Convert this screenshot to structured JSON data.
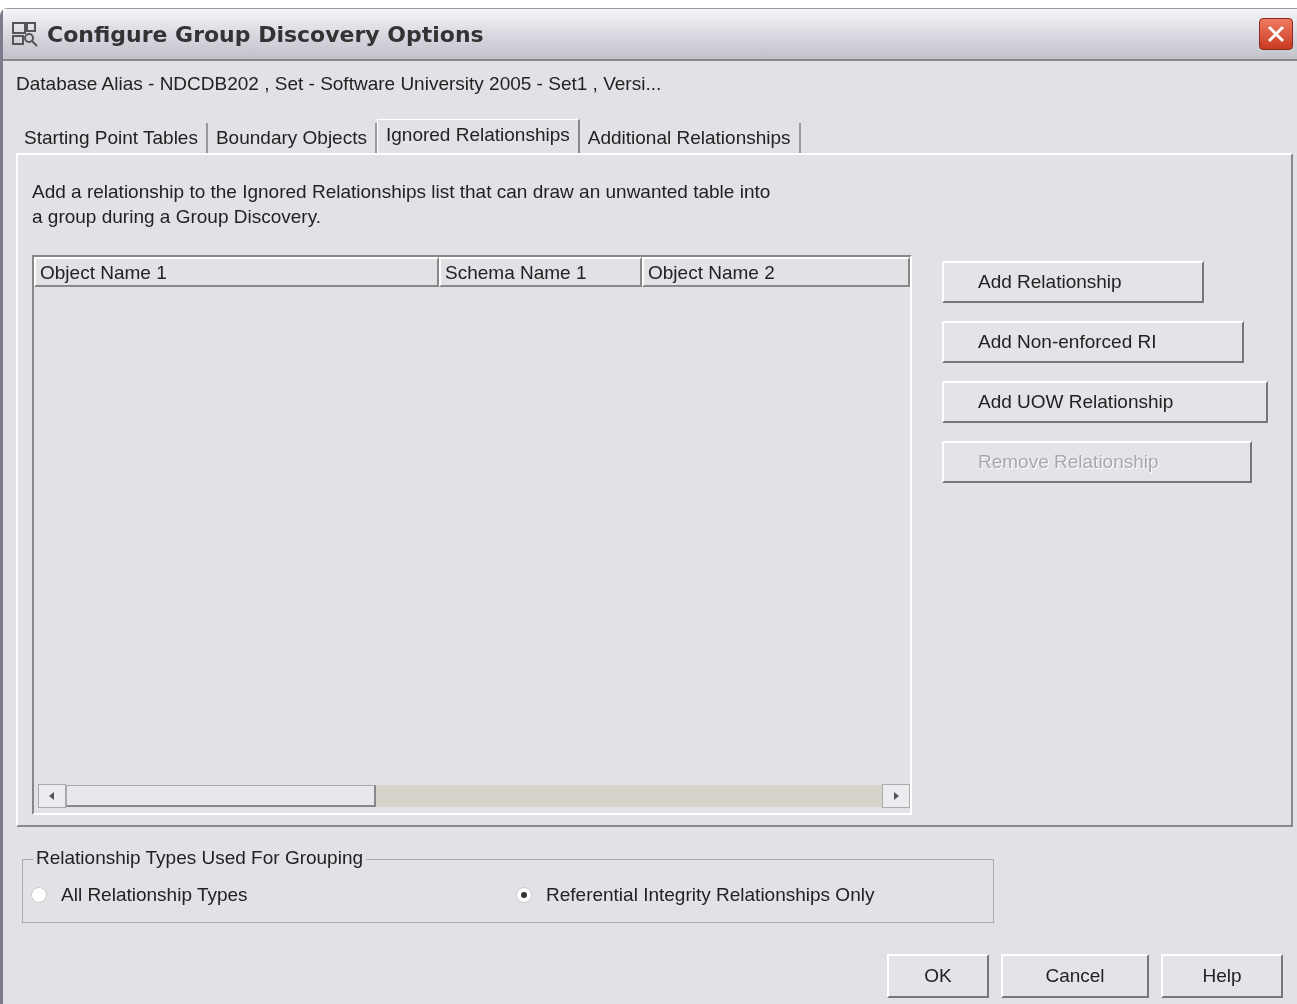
{
  "window": {
    "title": "Configure Group Discovery Options"
  },
  "context": "Database Alias - NDCDB202 , Set - Software University 2005 - Set1 , Versi...",
  "tabs": [
    {
      "label": "Starting Point Tables",
      "selected": false
    },
    {
      "label": "Boundary Objects",
      "selected": false
    },
    {
      "label": "Ignored Relationships",
      "selected": true
    },
    {
      "label": "Additional Relationships",
      "selected": false
    }
  ],
  "description": "Add a relationship to the Ignored Relationships list that can draw an unwanted table into a group during a Group Discovery.",
  "table": {
    "columns": [
      "Object Name 1",
      "Schema Name 1",
      "Object Name 2"
    ]
  },
  "actions": [
    {
      "label": "Add Relationship",
      "disabled": false
    },
    {
      "label": "Add Non-enforced RI",
      "disabled": false
    },
    {
      "label": "Add UOW Relationship",
      "disabled": false
    },
    {
      "label": "Remove Relationship",
      "disabled": true
    }
  ],
  "grouping": {
    "title": "Relationship Types Used For Grouping",
    "options": [
      {
        "label": "All Relationship Types",
        "selected": false
      },
      {
        "label": "Referential Integrity Relationships Only",
        "selected": true
      }
    ]
  },
  "buttons": [
    "OK",
    "Cancel",
    "Help"
  ]
}
